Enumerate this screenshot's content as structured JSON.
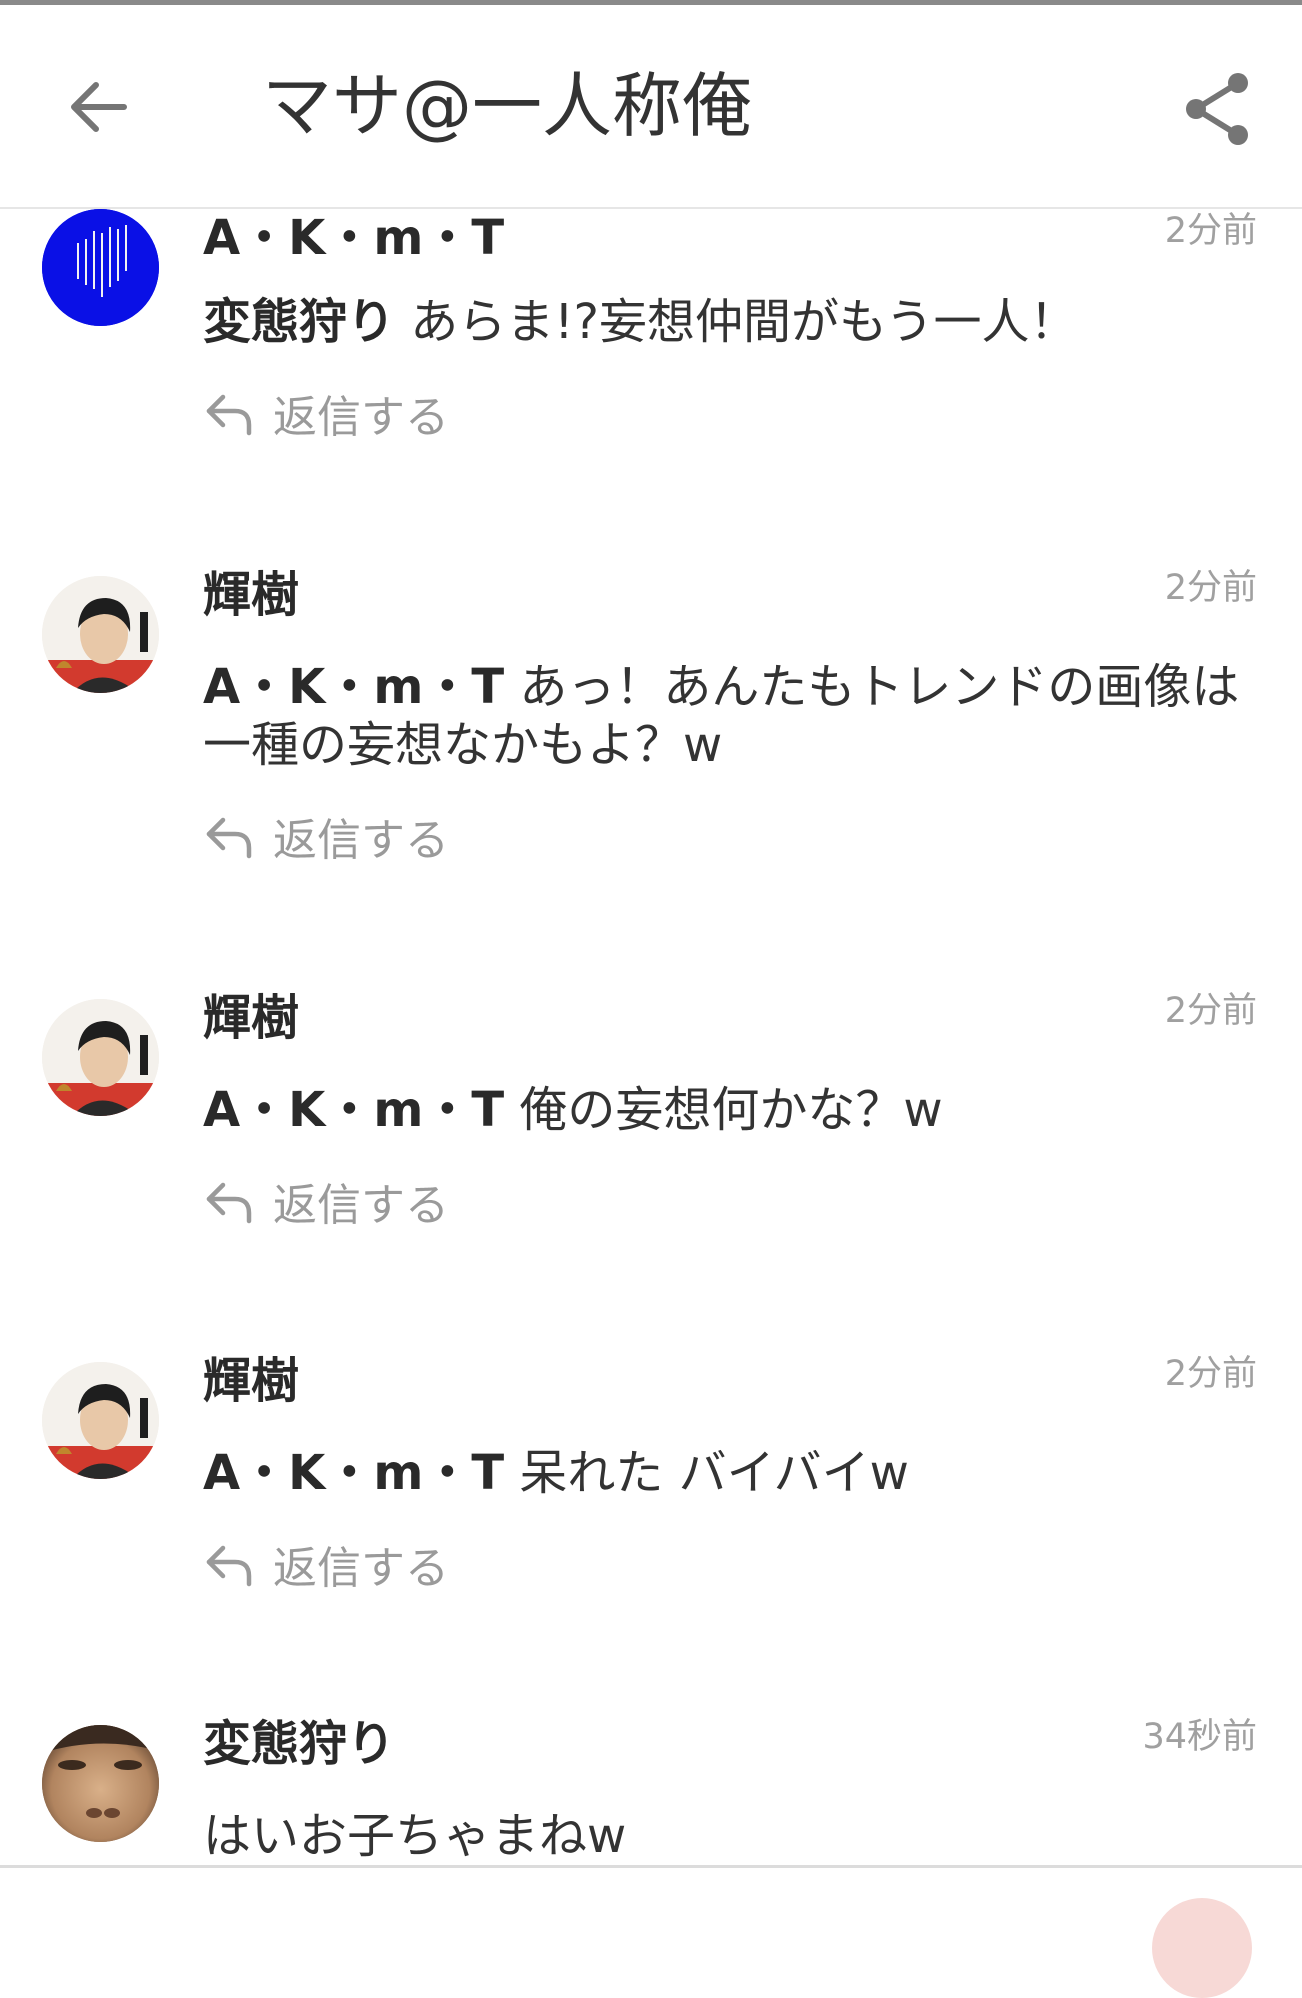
{
  "header": {
    "title": "マサ@一人称俺"
  },
  "icons": {
    "back": "arrow-left-icon",
    "share": "share-icon",
    "reply": "reply-arrow-icon"
  },
  "colors": {
    "text": "#333333",
    "muted": "#9a9a9a",
    "timestamp": "#a0a0a0",
    "divider": "#e6e6e6"
  },
  "comments": [
    {
      "author": "A・K・m・T",
      "time": "2分前",
      "mention": "変態狩り",
      "text": "あらま!?妄想仲間がもう一人！",
      "reply_label": "返信する"
    },
    {
      "author": "輝樹",
      "time": "2分前",
      "mention": "A・K・m・T",
      "text": "あっ！あんたもトレンドの画像は一種の妄想なかもよ？w",
      "reply_label": "返信する"
    },
    {
      "author": "輝樹",
      "time": "2分前",
      "mention": "A・K・m・T",
      "text": "俺の妄想何かな？w",
      "reply_label": "返信する"
    },
    {
      "author": "輝樹",
      "time": "2分前",
      "mention": "A・K・m・T",
      "text": "呆れた バイバイw",
      "reply_label": "返信する"
    },
    {
      "author": "変態狩り",
      "time": "34秒前",
      "mention": "",
      "text": "はいお子ちゃまねw"
    }
  ]
}
